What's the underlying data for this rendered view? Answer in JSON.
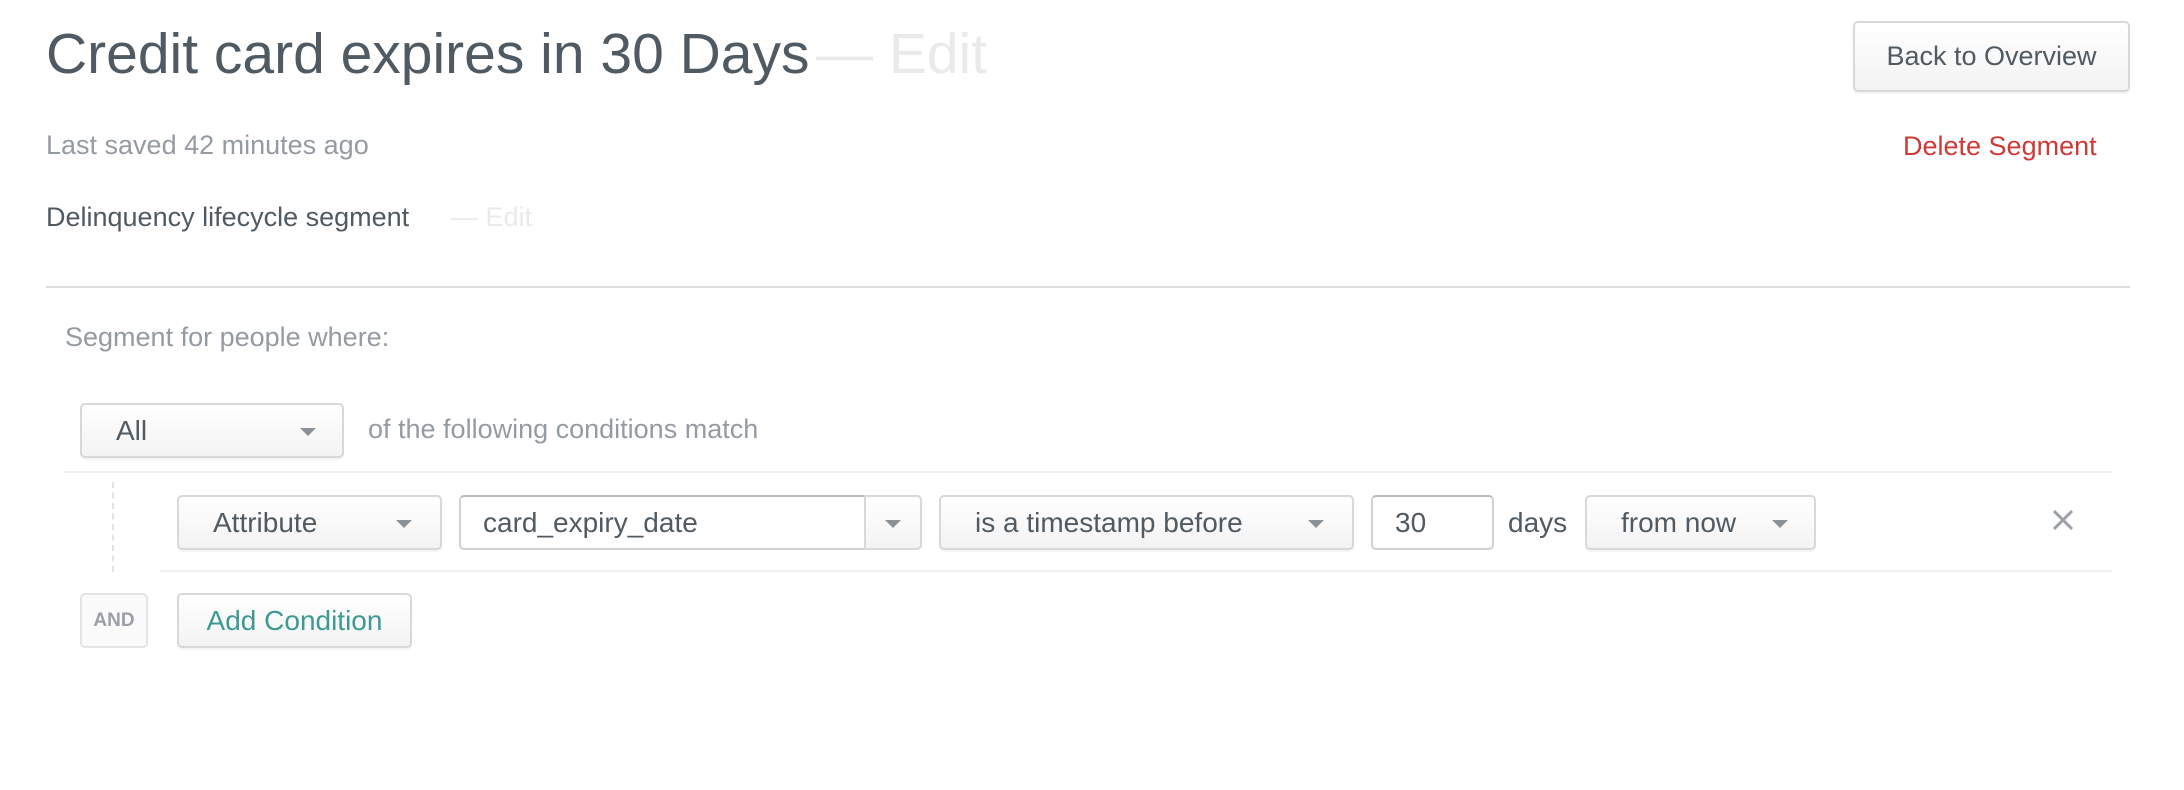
{
  "header": {
    "title": "Credit card expires in 30 Days",
    "title_edit_label": "— Edit",
    "back_button_label": "Back to Overview",
    "last_saved": "Last saved 42 minutes ago",
    "delete_label": "Delete Segment",
    "description": "Delinquency lifecycle segment",
    "description_edit_label": "— Edit"
  },
  "segment": {
    "intro_label": "Segment for people where:",
    "match_select_value": "All",
    "match_suffix": "of the following conditions match",
    "conditions": [
      {
        "type_value": "Attribute",
        "field_value": "card_expiry_date",
        "operator_value": "is a timestamp before",
        "amount_value": "30",
        "unit_label": "days",
        "relative_value": "from now",
        "remove_icon": "close-icon"
      }
    ],
    "and_badge": "AND",
    "add_condition_label": "Add Condition"
  },
  "colors": {
    "text": "#4f5a63",
    "muted": "#949ba2",
    "danger": "#cc3b36",
    "accent": "#3c9a93",
    "faint": "#e8eaec"
  }
}
